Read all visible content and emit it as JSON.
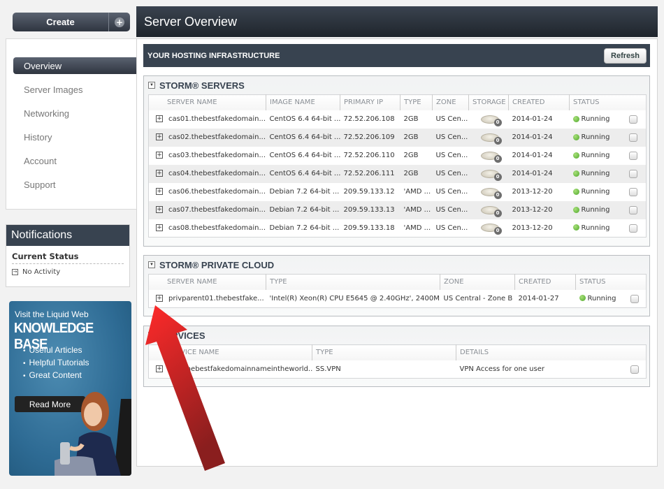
{
  "sidebar": {
    "create_label": "Create",
    "create_plus_icon": "+",
    "nav": [
      {
        "label": "Overview",
        "active": true
      },
      {
        "label": "Server Images"
      },
      {
        "label": "Networking"
      },
      {
        "label": "History"
      },
      {
        "label": "Account"
      },
      {
        "label": "Support"
      }
    ],
    "notifications": {
      "title": "Notifications",
      "subtitle": "Current Status",
      "item": "No Activity"
    },
    "ad": {
      "line1": "Visit the Liquid Web",
      "line2": "KNOWLEDGE BASE",
      "bullets": [
        "Useful Articles",
        "Helpful Tutorials",
        "Great Content"
      ],
      "button": "Read More"
    }
  },
  "header": {
    "title": "Server Overview"
  },
  "infrastructure": {
    "title": "YOUR HOSTING INFRASTRUCTURE",
    "refresh_label": "Refresh"
  },
  "storm_servers": {
    "title": "STORM® SERVERS",
    "columns": [
      "SERVER NAME",
      "IMAGE NAME",
      "PRIMARY IP",
      "TYPE",
      "ZONE",
      "STORAGE",
      "CREATED",
      "STATUS"
    ],
    "rows": [
      {
        "name": "cas01.thebestfakedomain...",
        "image": "CentOS 6.4 64-bit ...",
        "ip": "72.52.206.108",
        "type": "2GB",
        "zone": "US Cen...",
        "storage": "0",
        "created": "2014-01-24",
        "status": "Running"
      },
      {
        "name": "cas02.thebestfakedomain...",
        "image": "CentOS 6.4 64-bit ...",
        "ip": "72.52.206.109",
        "type": "2GB",
        "zone": "US Cen...",
        "storage": "0",
        "created": "2014-01-24",
        "status": "Running"
      },
      {
        "name": "cas03.thebestfakedomain...",
        "image": "CentOS 6.4 64-bit ...",
        "ip": "72.52.206.110",
        "type": "2GB",
        "zone": "US Cen...",
        "storage": "0",
        "created": "2014-01-24",
        "status": "Running"
      },
      {
        "name": "cas04.thebestfakedomain...",
        "image": "CentOS 6.4 64-bit ...",
        "ip": "72.52.206.111",
        "type": "2GB",
        "zone": "US Cen...",
        "storage": "0",
        "created": "2014-01-24",
        "status": "Running"
      },
      {
        "name": "cas06.thebestfakedomain...",
        "image": "Debian 7.2 64-bit ...",
        "ip": "209.59.133.12",
        "type": "'AMD ...",
        "zone": "US Cen...",
        "storage": "0",
        "created": "2013-12-20",
        "status": "Running"
      },
      {
        "name": "cas07.thebestfakedomain...",
        "image": "Debian 7.2 64-bit ...",
        "ip": "209.59.133.13",
        "type": "'AMD ...",
        "zone": "US Cen...",
        "storage": "0",
        "created": "2013-12-20",
        "status": "Running"
      },
      {
        "name": "cas08.thebestfakedomain...",
        "image": "Debian 7.2 64-bit ...",
        "ip": "209.59.133.18",
        "type": "'AMD ...",
        "zone": "US Cen...",
        "storage": "0",
        "created": "2013-12-20",
        "status": "Running"
      }
    ]
  },
  "private_cloud": {
    "title": "STORM® PRIVATE CLOUD",
    "columns": [
      "SERVER NAME",
      "TYPE",
      "ZONE",
      "CREATED",
      "STATUS"
    ],
    "rows": [
      {
        "name": "privparent01.thebestfake...",
        "type": "'Intel(R) Xeon(R) CPU E5645 @ 2.40GHz', 2400M...",
        "zone": "US Central - Zone B",
        "created": "2014-01-27",
        "status": "Running"
      }
    ]
  },
  "services": {
    "title": "SERVICES",
    "columns": [
      "SERVICE NAME",
      "TYPE",
      "DETAILS"
    ],
    "rows": [
      {
        "name": "vpn.thebestfakedomainnameintheworld...",
        "type": "SS.VPN",
        "details": "VPN Access for one user"
      }
    ]
  },
  "colors": {
    "dark_header": "#384350",
    "status_running": "#4ea72a",
    "annotation_arrow": "#d42020"
  }
}
